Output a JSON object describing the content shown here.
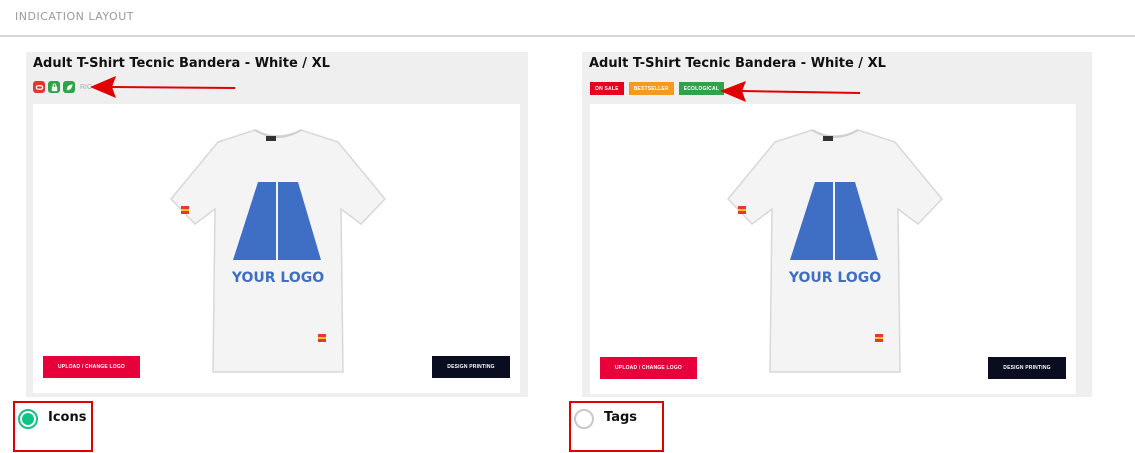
{
  "section": {
    "title": "INDICATION LAYOUT"
  },
  "cards": [
    {
      "title": "Adult T-Shirt Tecnic Bandera - White / XL",
      "mode": "icons",
      "icons": [
        {
          "name": "sale-icon",
          "color": "#e8352b"
        },
        {
          "name": "bag-icon",
          "color": "#2fa34a"
        },
        {
          "name": "leaf-icon",
          "color": "#2fa34a"
        }
      ],
      "icon_tail_text": "RIC",
      "image_logo_text": "YOUR LOGO",
      "upload_button": "UPLOAD / CHANGE LOGO",
      "design_button": "DESIGN PRINTING"
    },
    {
      "title": "Adult T-Shirt Tecnic Bandera - White / XL",
      "mode": "tags",
      "tags": [
        {
          "label": "ON SALE",
          "color": "#e8001c"
        },
        {
          "label": "BESTSELLER",
          "color": "#f59a1a"
        },
        {
          "label": "ECOLOGICAL",
          "color": "#2fa34a"
        }
      ],
      "image_logo_text": "YOUR LOGO",
      "upload_button": "UPLOAD / CHANGE LOGO",
      "design_button": "DESIGN PRINTING"
    }
  ],
  "options": [
    {
      "label": "Icons",
      "selected": true
    },
    {
      "label": "Tags",
      "selected": false
    }
  ],
  "colors": {
    "accent_green": "#12c286",
    "annotation_red": "#e00000",
    "upload_red": "#e8003b",
    "design_dark": "#0a0d1f"
  }
}
